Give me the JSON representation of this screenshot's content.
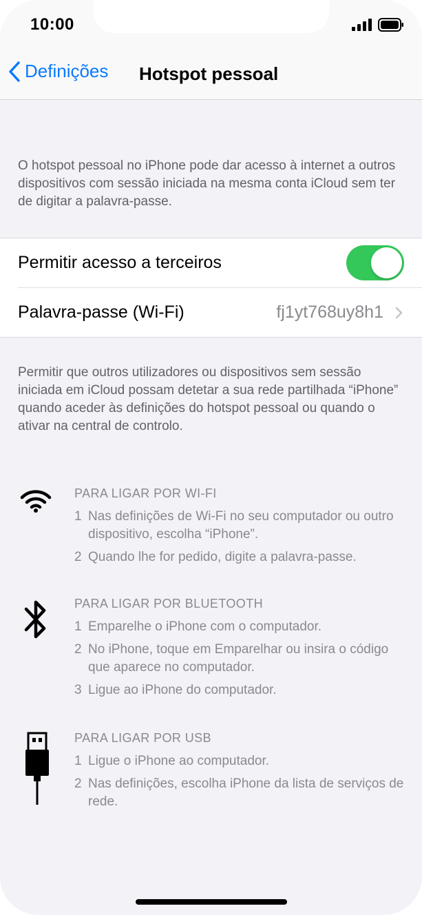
{
  "status_bar": {
    "time": "10:00"
  },
  "nav": {
    "back_label": "Definições",
    "title": "Hotspot pessoal"
  },
  "intro_text": "O hotspot pessoal no iPhone pode dar acesso à internet a outros dispositivos com sessão iniciada na mesma conta iCloud sem ter de digitar a palavra-passe.",
  "settings": {
    "allow_others_label": "Permitir acesso a terceiros",
    "allow_others_on": true,
    "password_label": "Palavra-passe (Wi-Fi)",
    "password_value": "fj1yt768uy8h1"
  },
  "footer_text": "Permitir que outros utilizadores ou dispositivos sem sessão iniciada em iCloud possam detetar a sua rede partilhada “iPhone” quando aceder às definições do hotspot pessoal ou quando o ativar na central de controlo.",
  "sections": [
    {
      "icon": "wifi-icon",
      "heading": "PARA LIGAR POR WI-FI",
      "steps": [
        {
          "num": "1",
          "text": "Nas definições de Wi-Fi no seu computador ou outro dispositivo, escolha “iPhone”."
        },
        {
          "num": "2",
          "text": "Quando lhe for pedido, digite a palavra-passe."
        }
      ]
    },
    {
      "icon": "bluetooth-icon",
      "heading": "PARA LIGAR POR BLUETOOTH",
      "steps": [
        {
          "num": "1",
          "text": "Emparelhe o iPhone com o computador."
        },
        {
          "num": "2",
          "text": "No iPhone, toque em Emparelhar ou insira o código que aparece no computador."
        },
        {
          "num": "3",
          "text": "Ligue ao iPhone do computador."
        }
      ]
    },
    {
      "icon": "usb-icon",
      "heading": "PARA LIGAR POR USB",
      "steps": [
        {
          "num": "1",
          "text": "Ligue o iPhone ao computador."
        },
        {
          "num": "2",
          "text": "Nas definições, escolha iPhone da lista de serviços de rede."
        }
      ]
    }
  ],
  "colors": {
    "accent": "#0a7aff",
    "toggle_on": "#34c759",
    "background": "#f2f2f7",
    "secondary_text": "#8a8a8e"
  }
}
